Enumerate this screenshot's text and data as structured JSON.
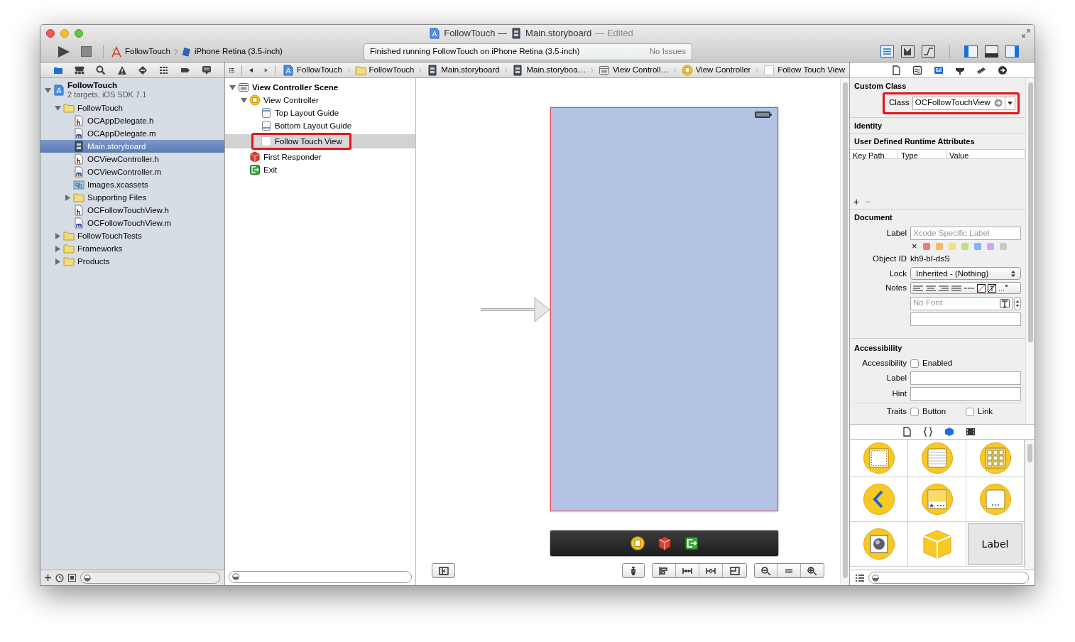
{
  "window": {
    "project": "FollowTouch —",
    "file": "Main.storyboard",
    "status": "— Edited"
  },
  "toolbar": {
    "scheme": "FollowTouch",
    "destination": "iPhone Retina (3.5-inch)",
    "activity": "Finished running FollowTouch on iPhone Retina (3.5-inch)",
    "issues": "No Issues",
    "editor_modes": [
      {
        "kind": "standard",
        "selected": true
      },
      {
        "kind": "assistant",
        "selected": false
      },
      {
        "kind": "version",
        "selected": false
      }
    ],
    "panels": [
      {
        "kind": "navigator",
        "on": true
      },
      {
        "kind": "debug",
        "on": false
      },
      {
        "kind": "utilities",
        "on": true
      }
    ]
  },
  "navigator_tabs": [
    {
      "kind": "folder",
      "selected": true
    },
    {
      "kind": "hierarchy",
      "selected": false
    },
    {
      "kind": "search",
      "selected": false
    },
    {
      "kind": "warning",
      "selected": false
    },
    {
      "kind": "test",
      "selected": false
    },
    {
      "kind": "debug",
      "selected": false
    },
    {
      "kind": "breakpoint",
      "selected": false
    },
    {
      "kind": "log",
      "selected": false
    }
  ],
  "jump_bar": [
    {
      "kind": "project",
      "label": "FollowTouch"
    },
    {
      "kind": "folder",
      "label": "FollowTouch"
    },
    {
      "kind": "storyboard",
      "label": "Main.storyboard"
    },
    {
      "kind": "storyboard",
      "label": "Main.storyboa…"
    },
    {
      "kind": "scene",
      "label": "View Controll…"
    },
    {
      "kind": "controller",
      "label": "View Controller"
    },
    {
      "kind": "view",
      "label": "Follow Touch View"
    }
  ],
  "project_tree": [
    {
      "kind": "project",
      "label": "FollowTouch",
      "subtitle": "2 targets, iOS SDK 7.1",
      "expanded": true,
      "selected": false,
      "children": [
        {
          "kind": "folder",
          "label": "FollowTouch",
          "expanded": true,
          "selected": false,
          "children": [
            {
              "kind": "h",
              "label": "OCAppDelegate.h",
              "selected": false
            },
            {
              "kind": "m",
              "label": "OCAppDelegate.m",
              "selected": false
            },
            {
              "kind": "storyboard",
              "label": "Main.storyboard",
              "selected": true
            },
            {
              "kind": "h",
              "label": "OCViewController.h",
              "selected": false
            },
            {
              "kind": "m",
              "label": "OCViewController.m",
              "selected": false
            },
            {
              "kind": "assets",
              "label": "Images.xcassets",
              "selected": false
            },
            {
              "kind": "folder",
              "label": "Supporting Files",
              "expanded": false,
              "selected": false
            },
            {
              "kind": "h",
              "label": "OCFollowTouchView.h",
              "selected": false
            },
            {
              "kind": "m",
              "label": "OCFollowTouchView.m",
              "selected": false
            }
          ]
        },
        {
          "kind": "folder",
          "label": "FollowTouchTests",
          "expanded": false,
          "selected": false
        },
        {
          "kind": "folder",
          "label": "Frameworks",
          "expanded": false,
          "selected": false
        },
        {
          "kind": "folder",
          "label": "Products",
          "expanded": false,
          "selected": false
        }
      ]
    }
  ],
  "outline": [
    {
      "kind": "scene",
      "label": "View Controller Scene",
      "expanded": true,
      "selected": false,
      "children": [
        {
          "kind": "controller",
          "label": "View Controller",
          "expanded": true,
          "selected": false,
          "children": [
            {
              "kind": "top-guide",
              "label": "Top Layout Guide",
              "selected": false
            },
            {
              "kind": "bottom-guide",
              "label": "Bottom Layout Guide",
              "selected": false
            },
            {
              "kind": "view",
              "label": "Follow Touch View",
              "selected": true,
              "annotated": true
            }
          ]
        },
        {
          "kind": "responder",
          "label": "First Responder",
          "selected": false
        },
        {
          "kind": "exit",
          "label": "Exit",
          "selected": false
        }
      ]
    }
  ],
  "canvas": {
    "dock": [
      {
        "kind": "controller"
      },
      {
        "kind": "responder"
      },
      {
        "kind": "exit"
      }
    ]
  },
  "inspector_tabs": [
    {
      "kind": "file",
      "selected": false
    },
    {
      "kind": "help",
      "selected": false
    },
    {
      "kind": "identity",
      "selected": true
    },
    {
      "kind": "attributes",
      "selected": false
    },
    {
      "kind": "size",
      "selected": false
    },
    {
      "kind": "connections",
      "selected": false
    }
  ],
  "custom_class": {
    "title": "Custom Class",
    "label": "Class",
    "value": "OCFollowTouchView",
    "annotated": true
  },
  "identity": {
    "title": "Identity"
  },
  "runtime_attributes": {
    "title": "User Defined Runtime Attributes",
    "columns": [
      "Key Path",
      "Type",
      "Value"
    ],
    "add": "+",
    "remove": "−"
  },
  "document": {
    "title": "Document",
    "label_label": "Label",
    "label_placeholder": "Xcode Specific Label",
    "clear": "×",
    "label_colors": [
      {
        "color": "#ec7b7d"
      },
      {
        "color": "#f6b865"
      },
      {
        "color": "#f1e56f"
      },
      {
        "color": "#bfe07c"
      },
      {
        "color": "#7fb6f3"
      },
      {
        "color": "#d2a6ea"
      },
      {
        "color": "#c9c9c9"
      }
    ],
    "object_id_label": "Object ID",
    "object_id": "kh9-bI-dsS",
    "lock_label": "Lock",
    "lock": "Inherited - (Nothing)",
    "notes_label": "Notes",
    "font_placeholder": "No Font"
  },
  "accessibility": {
    "title": "Accessibility",
    "enabled_label": "Accessibility",
    "enabled": {
      "label": "Enabled",
      "checked": false
    },
    "label_label": "Label",
    "hint_label": "Hint",
    "traits_label": "Traits",
    "traits": [
      {
        "label": "Button",
        "checked": false
      },
      {
        "label": "Link",
        "checked": false
      }
    ]
  },
  "library_tabs": [
    {
      "kind": "file",
      "selected": false
    },
    {
      "kind": "code",
      "selected": false
    },
    {
      "kind": "object",
      "selected": true
    },
    {
      "kind": "media",
      "selected": false
    }
  ],
  "library": [
    {
      "kind": "view"
    },
    {
      "kind": "table"
    },
    {
      "kind": "collection"
    },
    {
      "kind": "back"
    },
    {
      "kind": "tab-bar"
    },
    {
      "kind": "page"
    },
    {
      "kind": "glkit"
    },
    {
      "kind": "object"
    },
    {
      "kind": "label",
      "text": "Label"
    }
  ]
}
